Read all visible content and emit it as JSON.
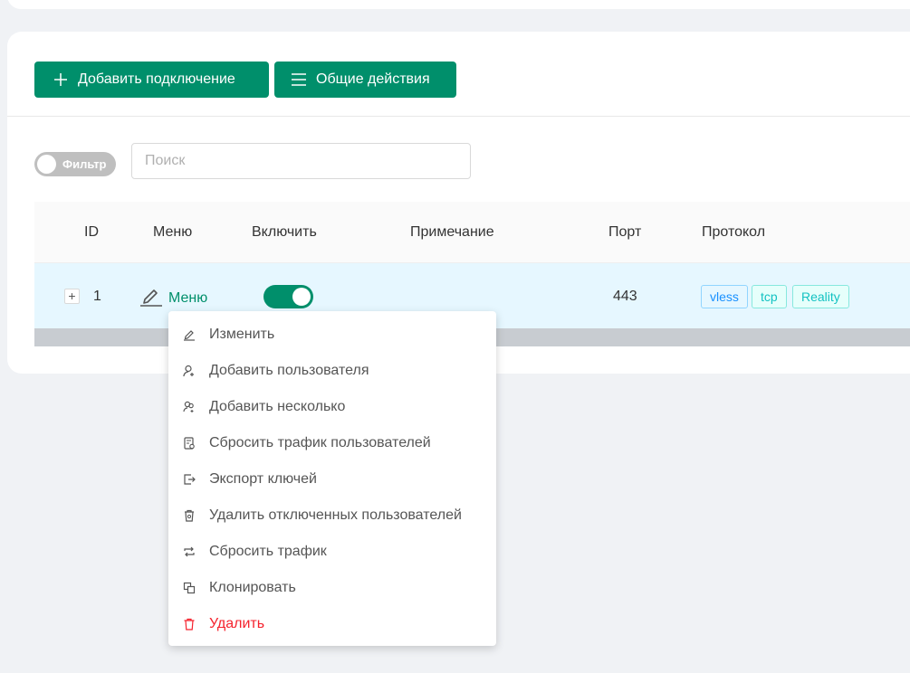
{
  "toolbar": {
    "add_label": "Добавить подключение",
    "actions_label": "Общие действия"
  },
  "filter": {
    "label": "Фильтр",
    "enabled": false
  },
  "search": {
    "placeholder": "Поиск",
    "value": ""
  },
  "table": {
    "columns": [
      "ID",
      "Меню",
      "Включить",
      "Примечание",
      "Порт",
      "Протокол"
    ],
    "rows": [
      {
        "expand": "+",
        "id": "1",
        "menu": "Меню",
        "enabled": true,
        "note": "",
        "port": "443",
        "tags": [
          "vless",
          "tcp",
          "Reality"
        ]
      }
    ]
  },
  "dropdown": {
    "items": [
      {
        "label": "Изменить",
        "icon": "edit-icon"
      },
      {
        "label": "Добавить пользователя",
        "icon": "user-add-icon"
      },
      {
        "label": "Добавить несколько",
        "icon": "users-add-icon"
      },
      {
        "label": "Сбросить трафик пользователей",
        "icon": "file-reset-icon"
      },
      {
        "label": "Экспорт ключей",
        "icon": "export-icon"
      },
      {
        "label": "Удалить отключенных пользователей",
        "icon": "trash-can-icon"
      },
      {
        "label": "Сбросить трафик",
        "icon": "retweet-icon"
      },
      {
        "label": "Клонировать",
        "icon": "copy-icon"
      },
      {
        "label": "Удалить",
        "icon": "delete-icon"
      }
    ]
  },
  "colors": {
    "primary": "#008f6b",
    "row_highlight": "#e6f7ff",
    "danger": "#f5222d",
    "tag_blue": "#1890ff",
    "tag_cyan": "#13c2c2"
  }
}
